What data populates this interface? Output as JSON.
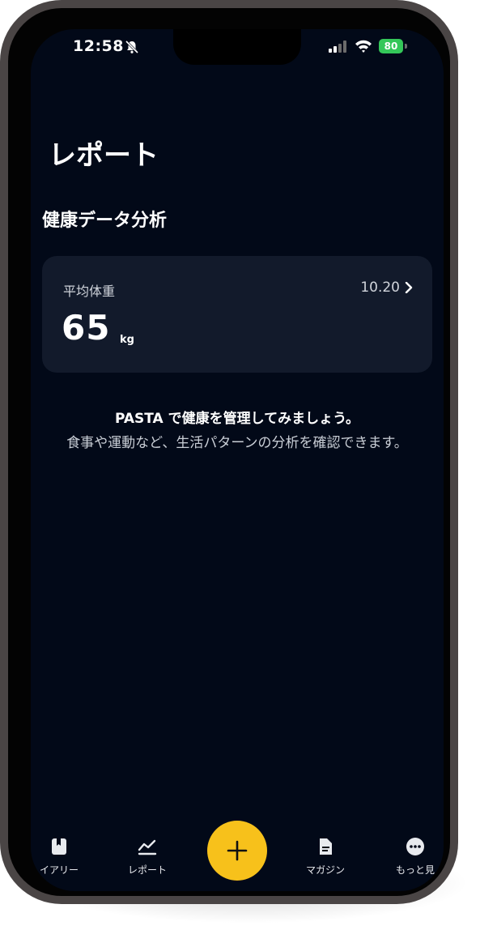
{
  "status_bar": {
    "time": "12:58",
    "battery": "80"
  },
  "page": {
    "title": "レポート"
  },
  "section": {
    "title": "健康データ分析"
  },
  "weight_card": {
    "label": "平均体重",
    "date": "10.20",
    "value": "65",
    "unit": "kg"
  },
  "empty_state": {
    "title": "PASTA で健康を管理してみましょう。",
    "body": "食事や運動など、生活パターンの分析を確認できます。"
  },
  "tab_bar": {
    "items": [
      {
        "label": "イアリー",
        "icon": "bookmark-icon"
      },
      {
        "label": "レポート",
        "icon": "chart-line-icon"
      },
      {
        "label": "マガジン",
        "icon": "document-icon"
      },
      {
        "label": "もっと見",
        "icon": "more-icon"
      }
    ],
    "fab_icon": "plus-icon",
    "accent_color": "#f7c11b"
  },
  "colors": {
    "background": "#020918",
    "card": "#121a2b",
    "battery": "#34c759"
  }
}
